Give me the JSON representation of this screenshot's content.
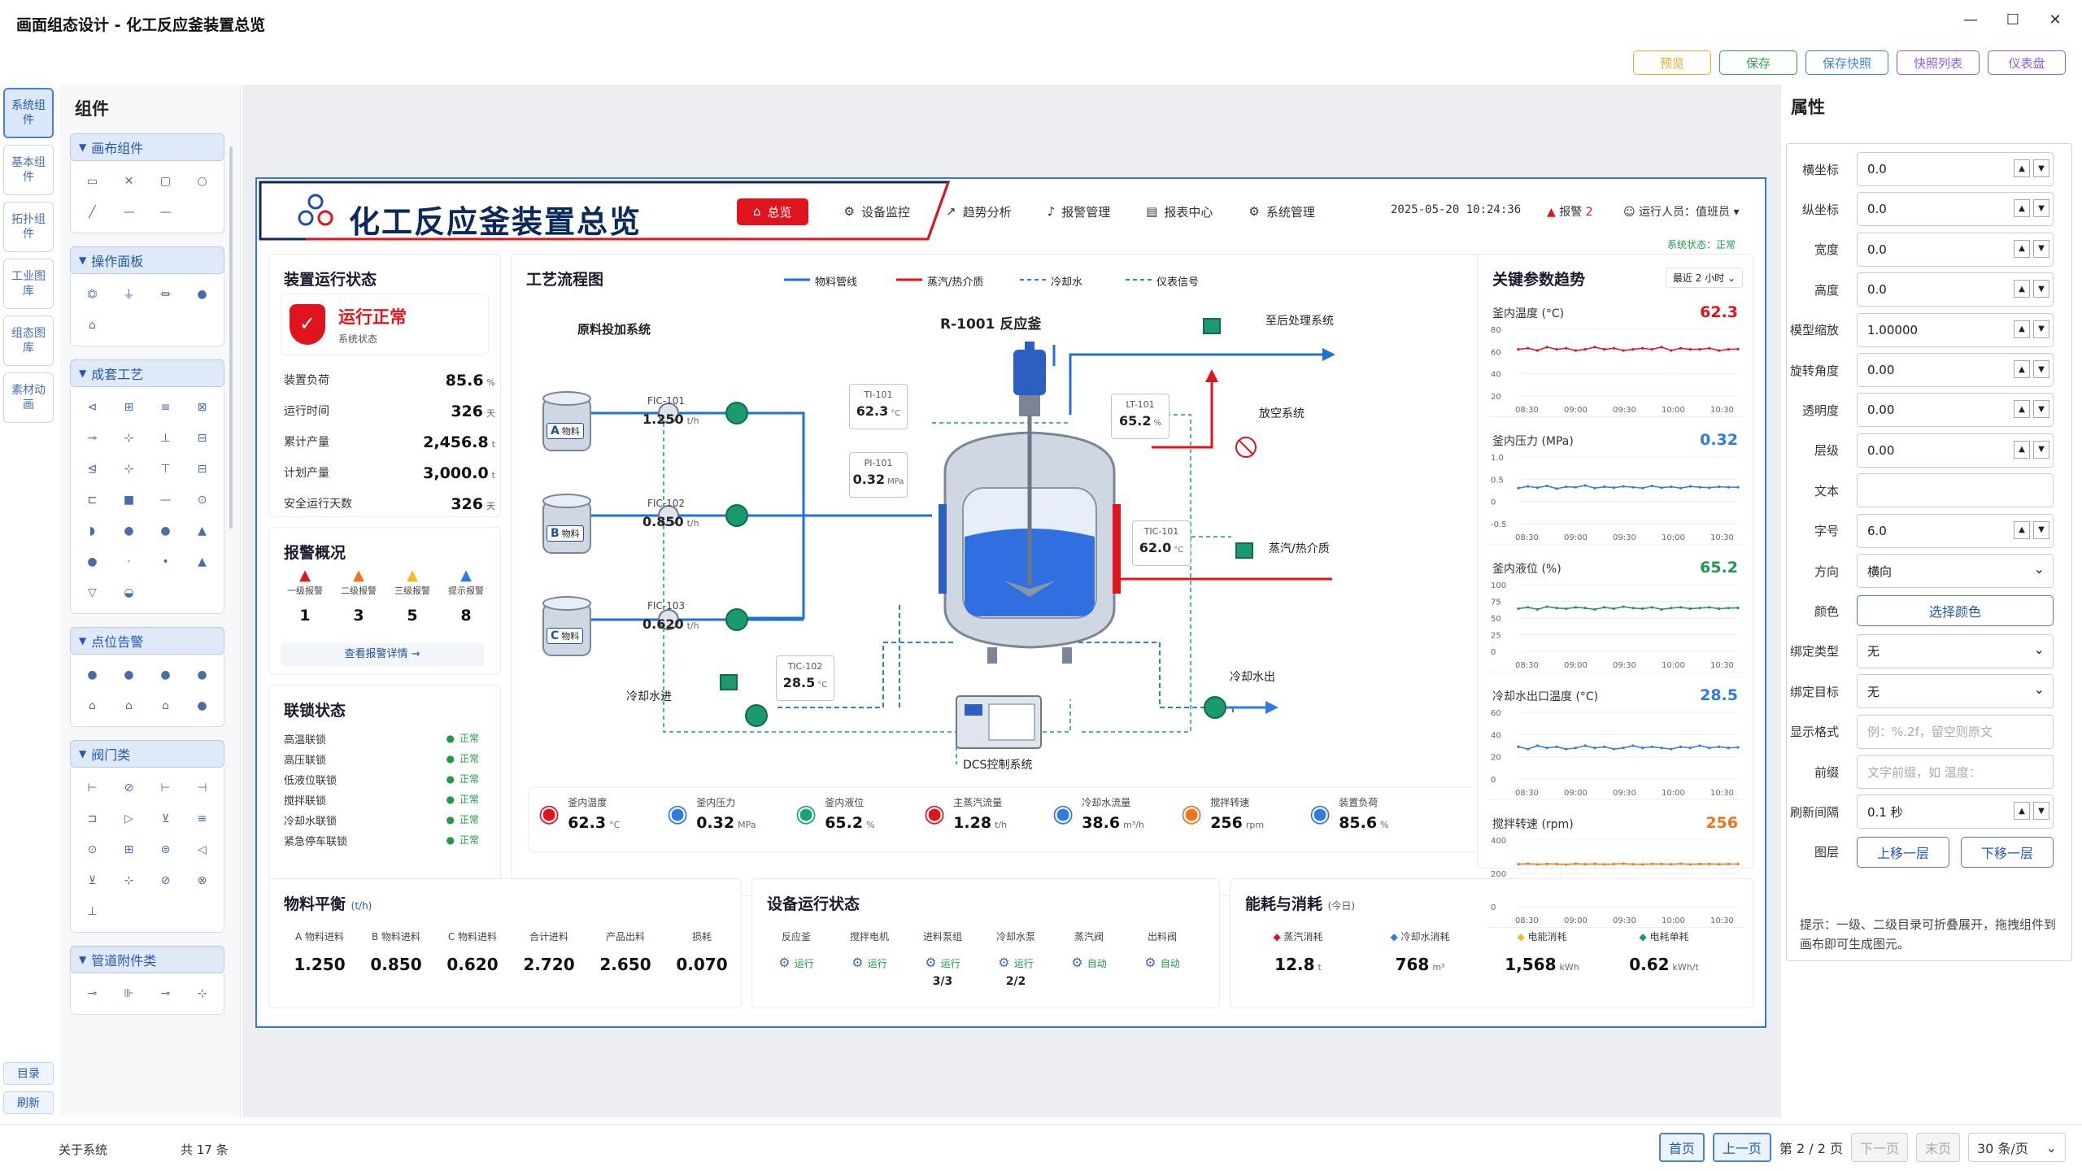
{
  "window": {
    "title": "画面组态设计 - 化工反应釜装置总览",
    "controls": [
      "—",
      "☐",
      "✕"
    ]
  },
  "toolbar": {
    "buttons": [
      {
        "label": "预览",
        "color": "#f5a623"
      },
      {
        "label": "保存",
        "color": "#2ea84a"
      },
      {
        "label": "保存快照",
        "color": "#3b82f6"
      },
      {
        "label": "快照列表",
        "color": "#8b5cf6"
      },
      {
        "label": "仪表盘",
        "color": "#8b5cf6"
      }
    ]
  },
  "left_tabs": [
    "系统组件",
    "基本组件",
    "拓扑组件",
    "工业图库",
    "组态图库",
    "素材动画"
  ],
  "left_bottom": [
    "目录",
    "刷新"
  ],
  "components": {
    "title": "组件",
    "groups": [
      {
        "name": "画布组件",
        "icons": [
          "▭",
          "✕",
          "▢",
          "○",
          "╱",
          "—",
          "—"
        ]
      },
      {
        "name": "操作面板",
        "icons": [
          "⏣",
          "⏚",
          "⏛",
          "●",
          "⌂"
        ]
      },
      {
        "name": "成套工艺",
        "icons": [
          "⊲",
          "⊞",
          "≡",
          "⊠",
          "⊸",
          "⊹",
          "⊥",
          "⊟",
          "⊴",
          "⊹",
          "⊤",
          "⊟",
          "⊏",
          "■",
          "—",
          "⊙",
          "◗",
          "●",
          "●",
          "▲",
          "●",
          "·",
          "•",
          "▲",
          "▽",
          "◒"
        ]
      },
      {
        "name": "点位告警",
        "icons": [
          "●",
          "●",
          "●",
          "●",
          "⌂",
          "⌂",
          "⌂",
          "●"
        ]
      },
      {
        "name": "阀门类",
        "icons": [
          "⊢",
          "⊘",
          "⊢",
          "⊣",
          "⊐",
          "▷",
          "⊻",
          "≡",
          "⊙",
          "⊞",
          "⊜",
          "◁",
          "⊻",
          "⊹",
          "⊘",
          "⊗",
          "⊥"
        ]
      },
      {
        "name": "管道附件类",
        "icons": [
          "⊸",
          "⊪",
          "⊸",
          "⊹"
        ]
      }
    ]
  },
  "properties": {
    "title": "属性",
    "rows": [
      {
        "label": "横坐标",
        "value": "0.0",
        "spin": true
      },
      {
        "label": "纵坐标",
        "value": "0.0",
        "spin": true
      },
      {
        "label": "宽度",
        "value": "0.0",
        "spin": true
      },
      {
        "label": "高度",
        "value": "0.0",
        "spin": true
      },
      {
        "label": "模型缩放",
        "value": "1.00000",
        "spin": true
      },
      {
        "label": "旋转角度",
        "value": "0.00",
        "spin": true
      },
      {
        "label": "透明度",
        "value": "0.00",
        "spin": true
      },
      {
        "label": "层级",
        "value": "0.00",
        "spin": true
      },
      {
        "label": "文本",
        "value": ""
      },
      {
        "label": "字号",
        "value": "6.0",
        "spin": true
      },
      {
        "label": "方向",
        "value": "横向",
        "select": true
      },
      {
        "label": "颜色",
        "button": "选择颜色"
      },
      {
        "label": "绑定类型",
        "value": "无",
        "select": true
      },
      {
        "label": "绑定目标",
        "value": "无",
        "select": true
      },
      {
        "label": "显示格式",
        "placeholder": "例：%.2f，留空则原文"
      },
      {
        "label": "前缀",
        "placeholder": "文字前缀，如 温度："
      },
      {
        "label": "刷新间隔",
        "value": "0.1 秒",
        "spin": true
      },
      {
        "label": "图层",
        "buttons": [
          "上移一层",
          "下移一层"
        ]
      }
    ],
    "hint": "提示：一级、二级目录可折叠展开，拖拽组件到画布即可生成图元。"
  },
  "statusbar": {
    "about": "关于系统",
    "count": "共 17 条",
    "first": "首页",
    "prev": "上一页",
    "page": "第 2 / 2 页",
    "next": "下一页",
    "last": "末页",
    "per_page": "30 条/页"
  },
  "dashboard": {
    "title": "化工反应釜装置总览",
    "nav": [
      "总览",
      "设备监控",
      "趋势分析",
      "报警管理",
      "报表中心",
      "系统管理"
    ],
    "datetime": "2025-05-20  10:24:36",
    "alarm_label": "报警",
    "alarm_count": "2",
    "operator": "运行人员：值班员",
    "system_status": "系统状态：正常",
    "status_panel": {
      "title": "装置运行状态",
      "state": "运行正常",
      "state_sub": "系统状态",
      "rows": [
        {
          "k": "装置负荷",
          "v": "85.6",
          "u": "%"
        },
        {
          "k": "运行时间",
          "v": "326",
          "u": "天"
        },
        {
          "k": "累计产量",
          "v": "2,456.8",
          "u": "t"
        },
        {
          "k": "计划产量",
          "v": "3,000.0",
          "u": "t"
        },
        {
          "k": "安全运行天数",
          "v": "326",
          "u": "天"
        }
      ]
    },
    "alarm_panel": {
      "title": "报警概况",
      "items": [
        {
          "label": "一级报警",
          "n": "1",
          "color": "#e0141c"
        },
        {
          "label": "二级报警",
          "n": "3",
          "color": "#f0731e"
        },
        {
          "label": "三级报警",
          "n": "5",
          "color": "#f5b81e"
        },
        {
          "label": "提示报警",
          "n": "8",
          "color": "#2f7be0"
        }
      ],
      "detail": "查看报警详情  →"
    },
    "interlock_panel": {
      "title": "联锁状态",
      "items": [
        {
          "k": "高温联锁",
          "v": "正常"
        },
        {
          "k": "高压联锁",
          "v": "正常"
        },
        {
          "k": "低液位联锁",
          "v": "正常"
        },
        {
          "k": "搅拌联锁",
          "v": "正常"
        },
        {
          "k": "冷却水联锁",
          "v": "正常"
        },
        {
          "k": "紧急停车联锁",
          "v": "正常"
        }
      ]
    },
    "process": {
      "title": "工艺流程图",
      "legend": [
        "物料管线",
        "蒸汽/热介质",
        "冷却水",
        "仪表信号"
      ],
      "feed_system": "原料投加系统",
      "reactor": "R-1001 反应釜",
      "to_post": "至后处理系统",
      "vent": "放空系统",
      "steam": "蒸汽/热介质",
      "cw_in": "冷却水进",
      "cw_out": "冷却水出",
      "dcs": "DCS控制系统",
      "tanks": [
        {
          "tag": "A",
          "label": "物料",
          "fic": "FIC-101",
          "flow": "1.250",
          "unit": "t/h"
        },
        {
          "tag": "B",
          "label": "物料",
          "fic": "FIC-102",
          "flow": "0.850",
          "unit": "t/h"
        },
        {
          "tag": "C",
          "label": "物料",
          "fic": "FIC-103",
          "flow": "0.620",
          "unit": "t/h"
        }
      ],
      "ti101": {
        "tag": "TI-101",
        "v": "62.3",
        "u": "°C"
      },
      "pi101": {
        "tag": "PI-101",
        "v": "0.32",
        "u": "MPa"
      },
      "lt101": {
        "tag": "LT-101",
        "v": "65.2",
        "u": "%"
      },
      "tic101": {
        "tag": "TIC-101",
        "v": "62.0",
        "u": "°C"
      },
      "tic102": {
        "tag": "TIC-102",
        "v": "28.5",
        "u": "°C"
      }
    },
    "gauges": [
      {
        "label": "釜内温度",
        "v": "62.3",
        "u": "°C",
        "color": "#e0141c"
      },
      {
        "label": "釜内压力",
        "v": "0.32",
        "u": "MPa",
        "color": "#2f7be0"
      },
      {
        "label": "釜内液位",
        "v": "65.2",
        "u": "%",
        "color": "#1aa37a"
      },
      {
        "label": "主蒸汽流量",
        "v": "1.28",
        "u": "t/h",
        "color": "#e0141c"
      },
      {
        "label": "冷却水流量",
        "v": "38.6",
        "u": "m³/h",
        "color": "#2f7be0"
      },
      {
        "label": "搅拌转速",
        "v": "256",
        "u": "rpm",
        "color": "#f0731e"
      },
      {
        "label": "装置负荷",
        "v": "85.6",
        "u": "%",
        "color": "#2f7be0"
      }
    ],
    "trend_panel": {
      "title": "关键参数趋势",
      "range": "最近 2 小时",
      "x_ticks": [
        "08:30",
        "09:00",
        "09:30",
        "10:00",
        "10:30"
      ]
    },
    "balance": {
      "title": "物料平衡",
      "unit": "(t/h)",
      "cols": [
        {
          "l": "A 物料进料",
          "v": "1.250"
        },
        {
          "l": "B 物料进料",
          "v": "0.850"
        },
        {
          "l": "C 物料进料",
          "v": "0.620"
        },
        {
          "l": "合计进料",
          "v": "2.720"
        },
        {
          "l": "产品出料",
          "v": "2.650"
        },
        {
          "l": "损耗",
          "v": "0.070"
        }
      ]
    },
    "equipment": {
      "title": "设备运行状态",
      "items": [
        {
          "l": "反应釜",
          "s": "运行",
          "extra": ""
        },
        {
          "l": "搅拌电机",
          "s": "运行",
          "extra": ""
        },
        {
          "l": "进料泵组",
          "s": "运行",
          "extra": "3/3"
        },
        {
          "l": "冷却水泵",
          "s": "运行",
          "extra": "2/2"
        },
        {
          "l": "蒸汽阀",
          "s": "自动",
          "extra": ""
        },
        {
          "l": "出料阀",
          "s": "自动",
          "extra": ""
        }
      ]
    },
    "energy": {
      "title": "能耗与消耗",
      "sub": "(今日)",
      "items": [
        {
          "l": "蒸汽消耗",
          "v": "12.8",
          "u": "t",
          "color": "#e0141c"
        },
        {
          "l": "冷却水消耗",
          "v": "768",
          "u": "m³",
          "color": "#2f7be0"
        },
        {
          "l": "电能消耗",
          "v": "1,568",
          "u": "kWh",
          "color": "#f5b81e"
        },
        {
          "l": "电耗单耗",
          "v": "0.62",
          "u": "kWh/t",
          "color": "#1d9a4b"
        }
      ]
    }
  },
  "chart_data": [
    {
      "type": "line",
      "title": "釜内温度 (°C)",
      "current": "62.3",
      "color": "#e0141c",
      "x": [
        "08:30",
        "09:00",
        "09:30",
        "10:00",
        "10:30"
      ],
      "ylim": [
        20,
        80
      ],
      "yticks": [
        "80",
        "60",
        "40",
        "20"
      ],
      "series": [
        {
          "values": [
            62,
            63,
            61,
            64,
            62,
            63,
            61,
            62,
            64,
            62,
            63,
            61,
            62,
            63,
            62,
            64,
            61,
            63,
            62,
            62,
            63,
            61,
            62,
            62.3
          ]
        }
      ]
    },
    {
      "type": "line",
      "title": "釜内压力 (MPa)",
      "current": "0.32",
      "color": "#2f7be0",
      "x": [
        "08:30",
        "09:00",
        "09:30",
        "10:00",
        "10:30"
      ],
      "ylim": [
        -0.5,
        1.0
      ],
      "yticks": [
        "1.0",
        "0.5",
        "0",
        "-0.5"
      ],
      "series": [
        {
          "values": [
            0.3,
            0.34,
            0.31,
            0.35,
            0.29,
            0.33,
            0.32,
            0.36,
            0.3,
            0.33,
            0.31,
            0.34,
            0.32,
            0.3,
            0.35,
            0.31,
            0.33,
            0.3,
            0.34,
            0.32,
            0.31,
            0.33,
            0.32,
            0.32
          ]
        }
      ]
    },
    {
      "type": "line",
      "title": "釜内液位 (%)",
      "current": "65.2",
      "color": "#1d9a4b",
      "x": [
        "08:30",
        "09:00",
        "09:30",
        "10:00",
        "10:30"
      ],
      "ylim": [
        0,
        100
      ],
      "yticks": [
        "100",
        "75",
        "50",
        "25",
        "0"
      ],
      "series": [
        {
          "values": [
            64,
            66,
            63,
            67,
            65,
            64,
            66,
            65,
            63,
            66,
            64,
            67,
            65,
            64,
            66,
            63,
            65,
            66,
            64,
            65,
            66,
            64,
            65,
            65.2
          ]
        }
      ]
    },
    {
      "type": "line",
      "title": "冷却水出口温度 (°C)",
      "current": "28.5",
      "color": "#2f7be0",
      "x": [
        "08:30",
        "09:00",
        "09:30",
        "10:00",
        "10:30"
      ],
      "ylim": [
        0,
        60
      ],
      "yticks": [
        "60",
        "40",
        "20",
        "0"
      ],
      "series": [
        {
          "values": [
            29,
            27,
            30,
            28,
            29,
            27,
            28,
            30,
            28,
            29,
            27,
            28,
            30,
            28,
            29,
            28,
            27,
            29,
            28,
            30,
            28,
            29,
            28,
            28.5
          ]
        }
      ]
    },
    {
      "type": "line",
      "title": "搅拌转速 (rpm)",
      "current": "256",
      "color": "#f0731e",
      "x": [
        "08:30",
        "09:00",
        "09:30",
        "10:00",
        "10:30"
      ],
      "ylim": [
        0,
        400
      ],
      "yticks": [
        "400",
        "200",
        "0"
      ],
      "series": [
        {
          "values": [
            255,
            258,
            254,
            257,
            256,
            253,
            258,
            255,
            257,
            254,
            256,
            258,
            255,
            254,
            257,
            256,
            255,
            258,
            254,
            256,
            257,
            255,
            256,
            256
          ]
        }
      ]
    }
  ]
}
